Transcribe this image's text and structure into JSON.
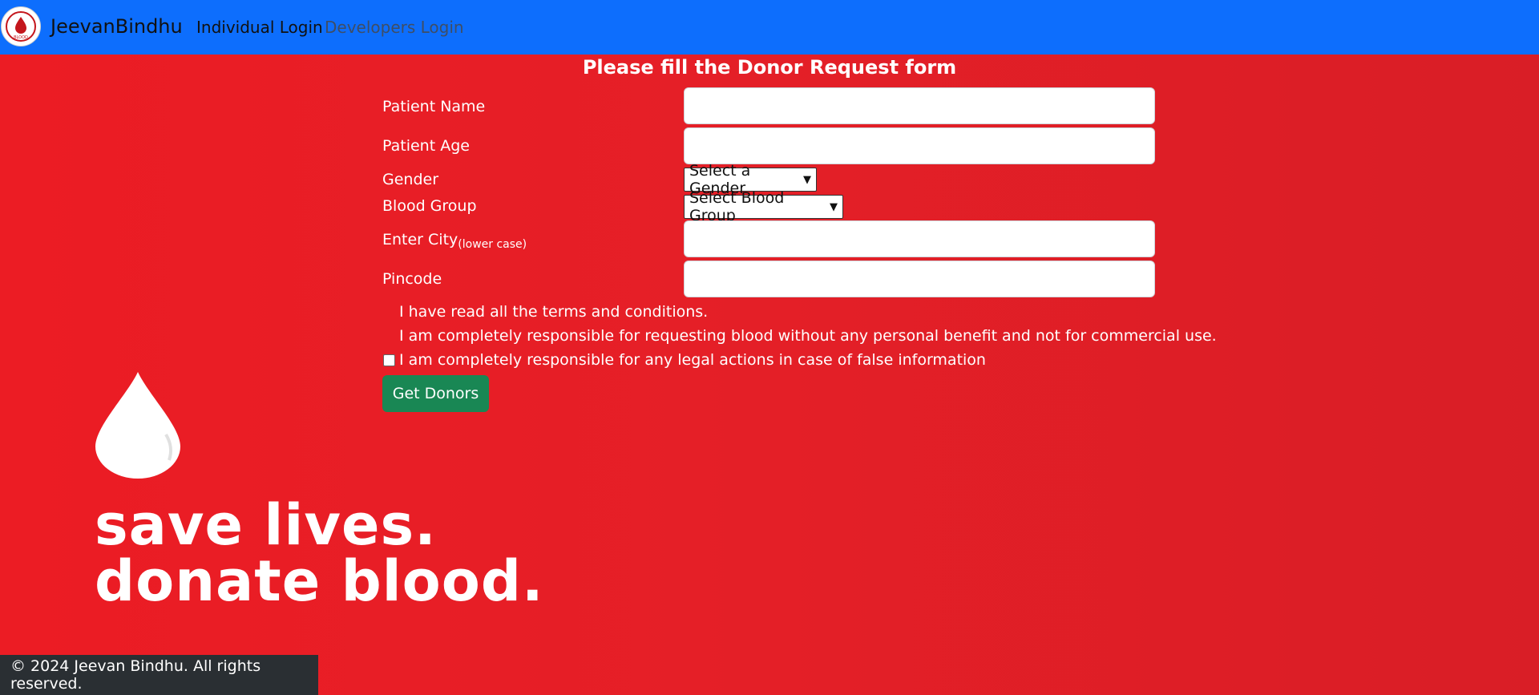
{
  "header": {
    "brand": "JeevanBindhu",
    "logo_text": "BLOOD",
    "nav": [
      {
        "label": "Individual Login"
      },
      {
        "label": "Developers Login"
      }
    ]
  },
  "form": {
    "title": "Please fill the Donor Request form",
    "patient_name": {
      "label": "Patient Name",
      "value": ""
    },
    "patient_age": {
      "label": "Patient Age",
      "value": ""
    },
    "gender": {
      "label": "Gender",
      "selected": "Select a Gender"
    },
    "blood_group": {
      "label": "Blood Group",
      "selected": "Select Blood Group"
    },
    "city": {
      "label": "Enter City",
      "hint": "(lower case)",
      "value": ""
    },
    "pincode": {
      "label": "Pincode",
      "value": ""
    },
    "terms": [
      "I have read all the terms and conditions.",
      "I am completely responsible for requesting blood without any personal benefit and not for commercial use.",
      "I am completely responsible for any legal actions in case of false information"
    ],
    "agree_checked": false,
    "submit_label": "Get Donors"
  },
  "hero": {
    "line1": "save lives.",
    "line2": "donate blood."
  },
  "footer": {
    "text": "© 2024 Jeevan Bindhu. All rights reserved."
  },
  "colors": {
    "navbar": "#0d6efd",
    "background": "#e51f27",
    "button": "#198754",
    "footer": "#2a2f33"
  }
}
